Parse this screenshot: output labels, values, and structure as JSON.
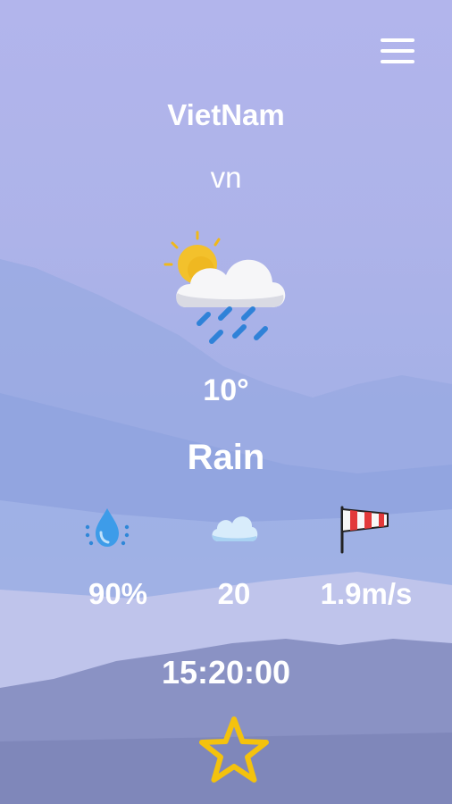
{
  "location": {
    "city": "VietNam",
    "country": "vn"
  },
  "weather": {
    "temperature": "10°",
    "description": "Rain",
    "icon": "sun-cloud-rain-icon"
  },
  "stats": {
    "humidity": {
      "value": "90%",
      "icon": "humidity-drop-icon"
    },
    "clouds": {
      "value": "20",
      "icon": "cloud-icon"
    },
    "wind": {
      "value": "1.9m/s",
      "icon": "windsock-icon"
    }
  },
  "time": "15:20:00",
  "favorite": {
    "icon": "star-icon",
    "color": "#f4c20d"
  },
  "menu": {
    "icon": "hamburger-menu-icon"
  }
}
